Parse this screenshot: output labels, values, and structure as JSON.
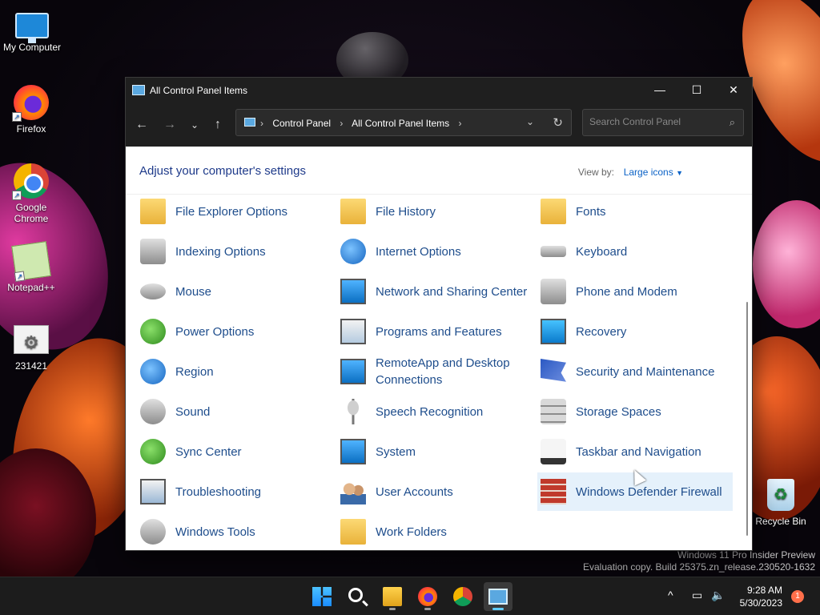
{
  "desktop": {
    "icons": [
      {
        "label": "My Computer"
      },
      {
        "label": "Firefox"
      },
      {
        "label": "Google Chrome"
      },
      {
        "label": "Notepad++"
      },
      {
        "label": "231421"
      },
      {
        "label": "Recycle Bin"
      }
    ],
    "watermark_line1": "Windows 11 Pro Insider Preview",
    "watermark_line2": "Evaluation copy. Build 25375.zn_release.230520-1632"
  },
  "window": {
    "title": "All Control Panel Items",
    "breadcrumb": [
      "Control Panel",
      "All Control Panel Items"
    ],
    "search_placeholder": "Search Control Panel",
    "heading": "Adjust your computer's settings",
    "view_by_label": "View by:",
    "view_by_value": "Large icons",
    "items": [
      {
        "label": "File Explorer Options",
        "icon": "folder-options-icon"
      },
      {
        "label": "File History",
        "icon": "file-history-icon"
      },
      {
        "label": "Fonts",
        "icon": "fonts-icon"
      },
      {
        "label": "Indexing Options",
        "icon": "indexing-icon"
      },
      {
        "label": "Internet Options",
        "icon": "globe-icon"
      },
      {
        "label": "Keyboard",
        "icon": "keyboard-icon"
      },
      {
        "label": "Mouse",
        "icon": "mouse-icon"
      },
      {
        "label": "Network and Sharing Center",
        "icon": "network-icon"
      },
      {
        "label": "Phone and Modem",
        "icon": "phone-icon"
      },
      {
        "label": "Power Options",
        "icon": "power-icon"
      },
      {
        "label": "Programs and Features",
        "icon": "programs-icon"
      },
      {
        "label": "Recovery",
        "icon": "recovery-icon"
      },
      {
        "label": "Region",
        "icon": "region-icon"
      },
      {
        "label": "RemoteApp and Desktop Connections",
        "icon": "remote-desktop-icon"
      },
      {
        "label": "Security and Maintenance",
        "icon": "flag-icon"
      },
      {
        "label": "Sound",
        "icon": "speaker-icon"
      },
      {
        "label": "Speech Recognition",
        "icon": "microphone-icon"
      },
      {
        "label": "Storage Spaces",
        "icon": "storage-icon"
      },
      {
        "label": "Sync Center",
        "icon": "sync-icon"
      },
      {
        "label": "System",
        "icon": "system-icon"
      },
      {
        "label": "Taskbar and Navigation",
        "icon": "taskbar-icon"
      },
      {
        "label": "Troubleshooting",
        "icon": "troubleshoot-icon"
      },
      {
        "label": "User Accounts",
        "icon": "users-icon"
      },
      {
        "label": "Windows Defender Firewall",
        "icon": "firewall-icon"
      },
      {
        "label": "Windows Tools",
        "icon": "tools-icon"
      },
      {
        "label": "Work Folders",
        "icon": "work-folders-icon"
      }
    ]
  },
  "taskbar": {
    "time": "9:28 AM",
    "date": "5/30/2023",
    "notification_count": "1"
  }
}
